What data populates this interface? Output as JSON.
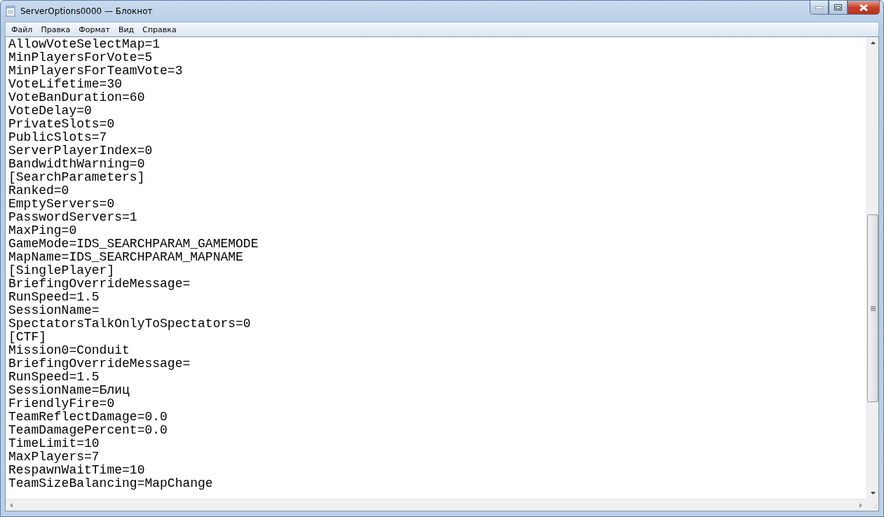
{
  "window": {
    "title": "ServerOptions0000 — Блокнот"
  },
  "menu": [
    "Файл",
    "Правка",
    "Формат",
    "Вид",
    "Справка"
  ],
  "lines": [
    "AllowVoteSelectMap=1",
    "MinPlayersForVote=5",
    "MinPlayersForTeamVote=3",
    "VoteLifetime=30",
    "VoteBanDuration=60",
    "VoteDelay=0",
    "PrivateSlots=0",
    "PublicSlots=7",
    "ServerPlayerIndex=0",
    "BandwidthWarning=0",
    "[SearchParameters]",
    "Ranked=0",
    "EmptyServers=0",
    "PasswordServers=1",
    "MaxPing=0",
    "GameMode=IDS_SEARCHPARAM_GAMEMODE",
    "MapName=IDS_SEARCHPARAM_MAPNAME",
    "[SinglePlayer]",
    "BriefingOverrideMessage=",
    "RunSpeed=1.5",
    "SessionName=",
    "SpectatorsTalkOnlyToSpectators=0",
    "[CTF]",
    "Mission0=Conduit",
    "BriefingOverrideMessage=",
    "RunSpeed=1.5",
    "SessionName=Блиц",
    "FriendlyFire=0",
    "TeamReflectDamage=0.0",
    "TeamDamagePercent=0.0",
    "TimeLimit=10",
    "MaxPlayers=7",
    "RespawnWaitTime=10",
    "TeamSizeBalancing=MapChange"
  ]
}
